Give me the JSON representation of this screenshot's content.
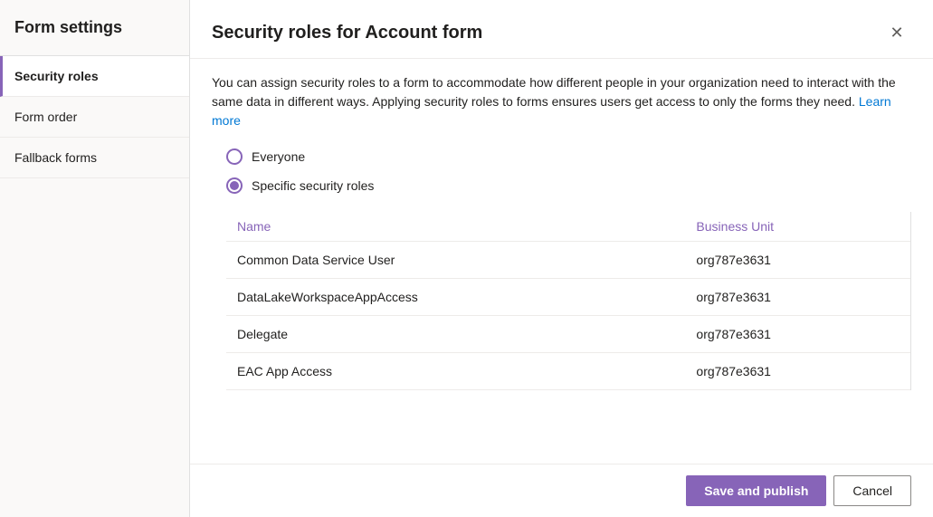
{
  "sidebar": {
    "title": "Form settings",
    "items": [
      {
        "id": "security-roles",
        "label": "Security roles",
        "active": true
      },
      {
        "id": "form-order",
        "label": "Form order",
        "active": false
      },
      {
        "id": "fallback-forms",
        "label": "Fallback forms",
        "active": false
      }
    ]
  },
  "dialog": {
    "title": "Security roles for Account form",
    "description_part1": "You can assign security roles to a form to accommodate how different people in your organization need to interact with the same data in different ways. Applying security roles to forms ensures users get access to only the forms they need.",
    "learn_more_label": "Learn more",
    "radio_options": [
      {
        "id": "everyone",
        "label": "Everyone",
        "checked": false
      },
      {
        "id": "specific",
        "label": "Specific security roles",
        "checked": true
      }
    ],
    "table": {
      "columns": [
        {
          "id": "name",
          "label": "Name"
        },
        {
          "id": "business_unit",
          "label": "Business Unit"
        }
      ],
      "rows": [
        {
          "name": "Common Data Service User",
          "business_unit": "org787e3631"
        },
        {
          "name": "DataLakeWorkspaceAppAccess",
          "business_unit": "org787e3631"
        },
        {
          "name": "Delegate",
          "business_unit": "org787e3631"
        },
        {
          "name": "EAC App Access",
          "business_unit": "org787e3631"
        }
      ]
    }
  },
  "footer": {
    "save_publish_label": "Save and publish",
    "cancel_label": "Cancel"
  },
  "icons": {
    "close": "✕"
  }
}
